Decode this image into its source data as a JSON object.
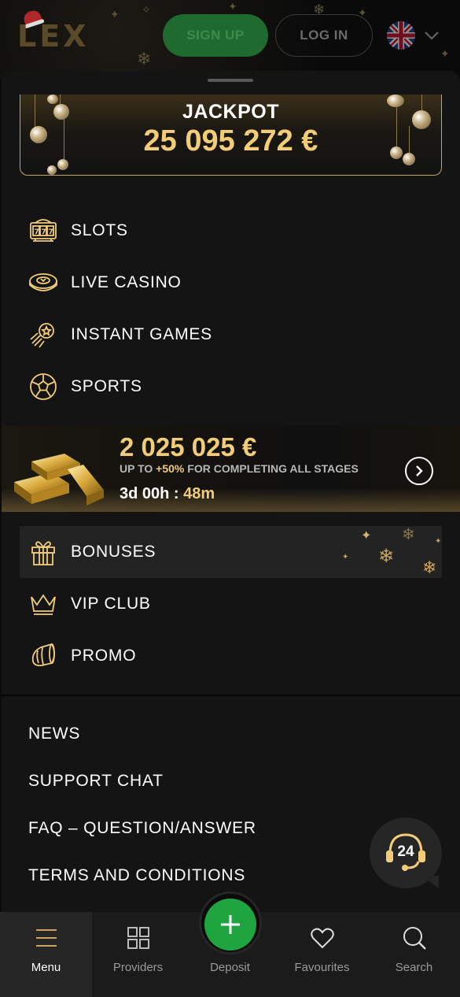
{
  "header": {
    "logo_text": "LEX",
    "signup_label": "SIGN UP",
    "login_label": "LOG IN",
    "language_flag": "uk-flag-icon"
  },
  "jackpot": {
    "title": "JACKPOT",
    "amount": "25 095 272 €"
  },
  "main_menu": [
    {
      "label": "SLOTS",
      "icon": "slot-machine-icon"
    },
    {
      "label": "LIVE CASINO",
      "icon": "live-casino-chip-icon"
    },
    {
      "label": "INSTANT GAMES",
      "icon": "instant-games-rocket-icon"
    },
    {
      "label": "SPORTS",
      "icon": "soccer-ball-icon"
    }
  ],
  "promo": {
    "amount": "2 025 025 €",
    "sub_prefix": "UP TO ",
    "sub_highlight": "+50%",
    "sub_suffix": " FOR COMPLETING ALL STAGES",
    "timer_main": "3d 00h : ",
    "timer_minutes": "48m"
  },
  "secondary_menu": [
    {
      "label": "BONUSES",
      "icon": "gift-icon"
    },
    {
      "label": "VIP CLUB",
      "icon": "crown-icon"
    },
    {
      "label": "PROMO",
      "icon": "megaphone-icon"
    }
  ],
  "links": [
    "NEWS",
    "SUPPORT CHAT",
    "FAQ – QUESTION/ANSWER",
    "TERMS AND CONDITIONS"
  ],
  "support_bubble": {
    "text": "24"
  },
  "bottom_nav": {
    "menu": "Menu",
    "providers": "Providers",
    "deposit": "Deposit",
    "favourites": "Favourites",
    "search": "Search"
  },
  "colors": {
    "gold": "#f2cc77",
    "green": "#1fa540",
    "background": "#141414"
  }
}
